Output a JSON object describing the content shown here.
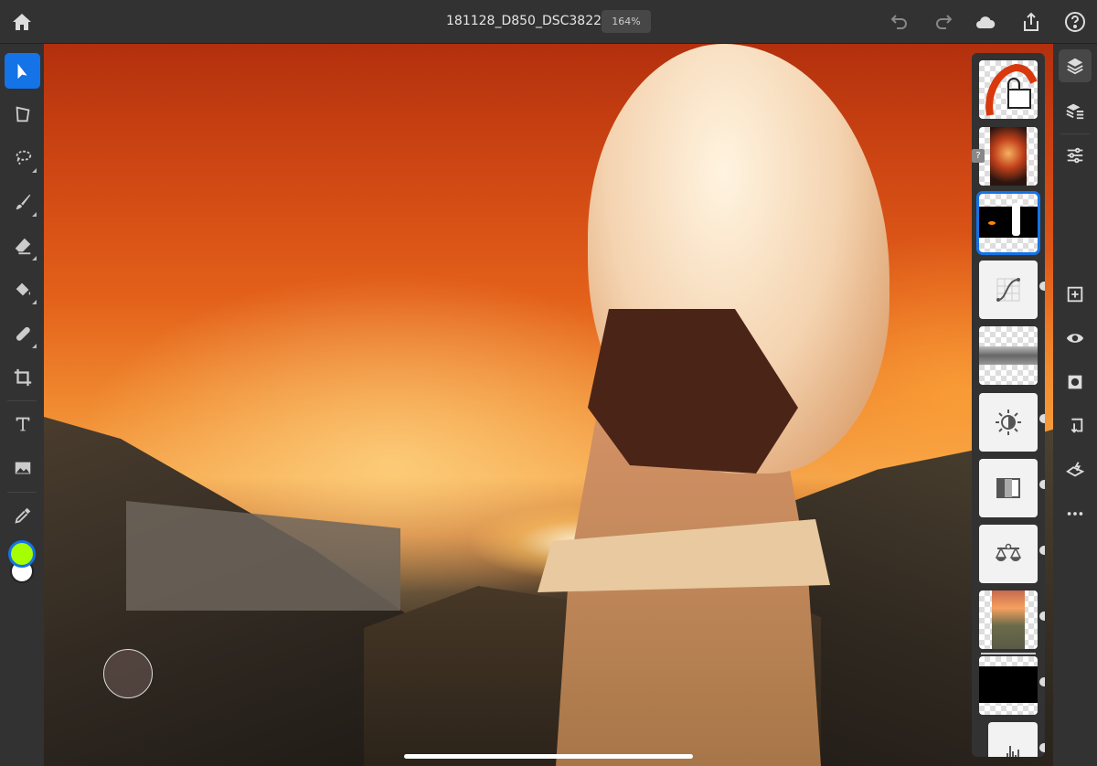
{
  "header": {
    "document_title": "181128_D850_DSC3822",
    "zoom_level": "164%"
  },
  "icons": {
    "home": "home-icon",
    "undo": "undo-icon",
    "redo": "redo-icon",
    "cloud": "cloud-icon",
    "share": "share-icon",
    "help": "help-icon"
  },
  "tools": [
    "select",
    "transform",
    "lasso",
    "brush",
    "eraser",
    "paint-bucket",
    "healing",
    "crop",
    "type",
    "place-image",
    "eyedropper"
  ],
  "colors": {
    "accent": "#1473e6",
    "foreground": "#a6ff00",
    "background": "#ffffff"
  },
  "layers": {
    "unknown_badge": "?",
    "items": [
      "locked-red-stroke",
      "fire-photo",
      "black-mask-layer",
      "curves-adjustment",
      "smoke-layer",
      "brightness-contrast-adjustment",
      "levels-adjustment",
      "color-balance-adjustment",
      "composite-group",
      "black-layer",
      "histogram-adjustment"
    ],
    "selected_index": 2
  },
  "right_panel": [
    "layers",
    "layer-properties",
    "adjustments",
    "add-layer",
    "visibility",
    "mask",
    "import",
    "quick-actions",
    "more"
  ]
}
